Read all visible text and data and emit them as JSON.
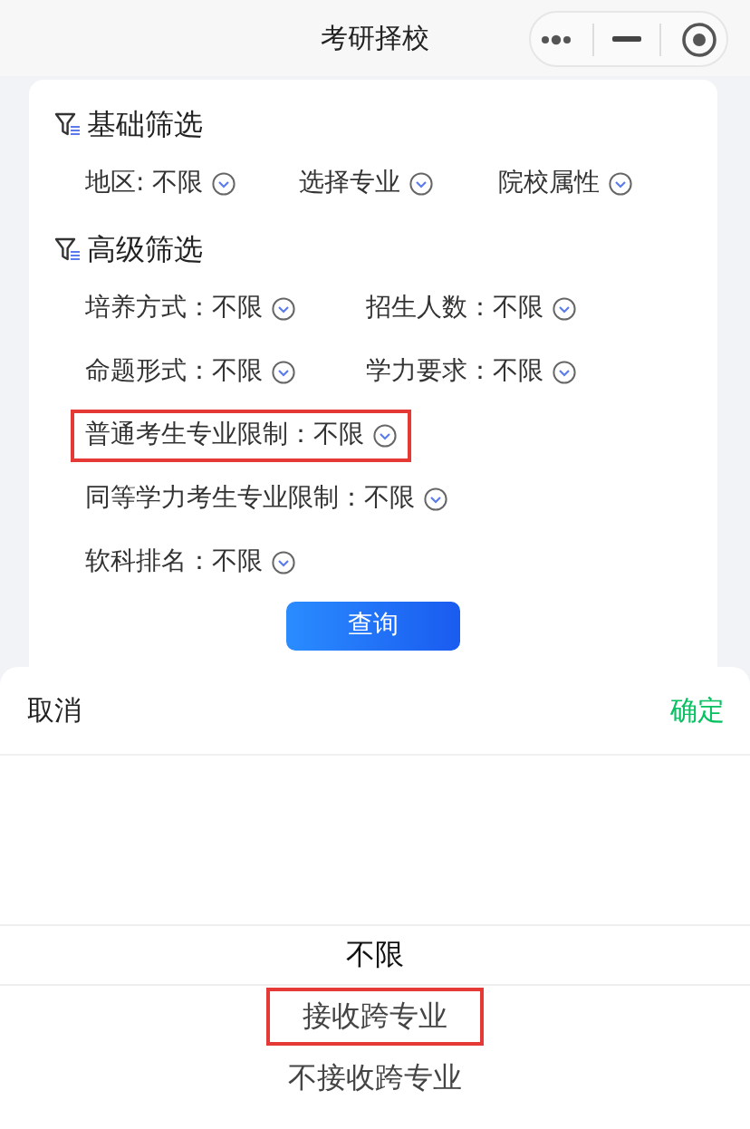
{
  "window": {
    "title": "考研择校"
  },
  "sections": [
    {
      "title": "基础筛选",
      "kind": "basic",
      "rows": [
        [
          {
            "label": "地区: 不限",
            "highlighted": false
          },
          {
            "label": "选择专业",
            "highlighted": false
          },
          {
            "label": "院校属性",
            "highlighted": false
          }
        ]
      ]
    },
    {
      "title": "高级筛选",
      "kind": "advanced",
      "rows": [
        [
          {
            "label": "培养方式：不限",
            "highlighted": false
          },
          {
            "label": "招生人数：不限",
            "highlighted": false
          }
        ],
        [
          {
            "label": "命题形式：不限",
            "highlighted": false
          },
          {
            "label": "学力要求：不限",
            "highlighted": false
          }
        ],
        [
          {
            "label": "普通考生专业限制：不限",
            "highlighted": true
          }
        ],
        [
          {
            "label": "同等学力考生专业限制：不限",
            "highlighted": false
          }
        ],
        [
          {
            "label": "软科排名：不限",
            "highlighted": false
          }
        ]
      ]
    }
  ],
  "query_button": "查询",
  "picker": {
    "cancel": "取消",
    "confirm": "确定",
    "options": [
      {
        "label": "不限",
        "selected": true,
        "highlighted": false
      },
      {
        "label": "接收跨专业",
        "selected": false,
        "highlighted": true
      },
      {
        "label": "不接收跨专业",
        "selected": false,
        "highlighted": false
      }
    ]
  }
}
